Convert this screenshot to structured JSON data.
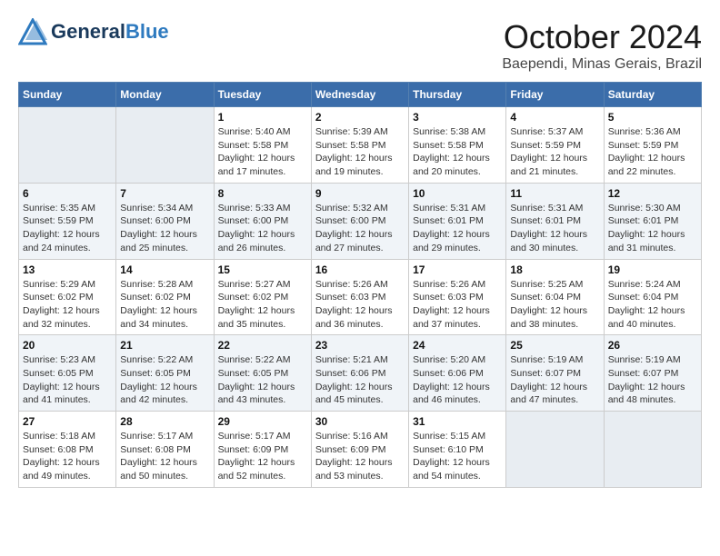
{
  "header": {
    "logo_general": "General",
    "logo_blue": "Blue",
    "month": "October 2024",
    "location": "Baependi, Minas Gerais, Brazil"
  },
  "days_of_week": [
    "Sunday",
    "Monday",
    "Tuesday",
    "Wednesday",
    "Thursday",
    "Friday",
    "Saturday"
  ],
  "weeks": [
    [
      {
        "num": "",
        "sunrise": "",
        "sunset": "",
        "daylight": ""
      },
      {
        "num": "",
        "sunrise": "",
        "sunset": "",
        "daylight": ""
      },
      {
        "num": "1",
        "sunrise": "Sunrise: 5:40 AM",
        "sunset": "Sunset: 5:58 PM",
        "daylight": "Daylight: 12 hours and 17 minutes."
      },
      {
        "num": "2",
        "sunrise": "Sunrise: 5:39 AM",
        "sunset": "Sunset: 5:58 PM",
        "daylight": "Daylight: 12 hours and 19 minutes."
      },
      {
        "num": "3",
        "sunrise": "Sunrise: 5:38 AM",
        "sunset": "Sunset: 5:58 PM",
        "daylight": "Daylight: 12 hours and 20 minutes."
      },
      {
        "num": "4",
        "sunrise": "Sunrise: 5:37 AM",
        "sunset": "Sunset: 5:59 PM",
        "daylight": "Daylight: 12 hours and 21 minutes."
      },
      {
        "num": "5",
        "sunrise": "Sunrise: 5:36 AM",
        "sunset": "Sunset: 5:59 PM",
        "daylight": "Daylight: 12 hours and 22 minutes."
      }
    ],
    [
      {
        "num": "6",
        "sunrise": "Sunrise: 5:35 AM",
        "sunset": "Sunset: 5:59 PM",
        "daylight": "Daylight: 12 hours and 24 minutes."
      },
      {
        "num": "7",
        "sunrise": "Sunrise: 5:34 AM",
        "sunset": "Sunset: 6:00 PM",
        "daylight": "Daylight: 12 hours and 25 minutes."
      },
      {
        "num": "8",
        "sunrise": "Sunrise: 5:33 AM",
        "sunset": "Sunset: 6:00 PM",
        "daylight": "Daylight: 12 hours and 26 minutes."
      },
      {
        "num": "9",
        "sunrise": "Sunrise: 5:32 AM",
        "sunset": "Sunset: 6:00 PM",
        "daylight": "Daylight: 12 hours and 27 minutes."
      },
      {
        "num": "10",
        "sunrise": "Sunrise: 5:31 AM",
        "sunset": "Sunset: 6:01 PM",
        "daylight": "Daylight: 12 hours and 29 minutes."
      },
      {
        "num": "11",
        "sunrise": "Sunrise: 5:31 AM",
        "sunset": "Sunset: 6:01 PM",
        "daylight": "Daylight: 12 hours and 30 minutes."
      },
      {
        "num": "12",
        "sunrise": "Sunrise: 5:30 AM",
        "sunset": "Sunset: 6:01 PM",
        "daylight": "Daylight: 12 hours and 31 minutes."
      }
    ],
    [
      {
        "num": "13",
        "sunrise": "Sunrise: 5:29 AM",
        "sunset": "Sunset: 6:02 PM",
        "daylight": "Daylight: 12 hours and 32 minutes."
      },
      {
        "num": "14",
        "sunrise": "Sunrise: 5:28 AM",
        "sunset": "Sunset: 6:02 PM",
        "daylight": "Daylight: 12 hours and 34 minutes."
      },
      {
        "num": "15",
        "sunrise": "Sunrise: 5:27 AM",
        "sunset": "Sunset: 6:02 PM",
        "daylight": "Daylight: 12 hours and 35 minutes."
      },
      {
        "num": "16",
        "sunrise": "Sunrise: 5:26 AM",
        "sunset": "Sunset: 6:03 PM",
        "daylight": "Daylight: 12 hours and 36 minutes."
      },
      {
        "num": "17",
        "sunrise": "Sunrise: 5:26 AM",
        "sunset": "Sunset: 6:03 PM",
        "daylight": "Daylight: 12 hours and 37 minutes."
      },
      {
        "num": "18",
        "sunrise": "Sunrise: 5:25 AM",
        "sunset": "Sunset: 6:04 PM",
        "daylight": "Daylight: 12 hours and 38 minutes."
      },
      {
        "num": "19",
        "sunrise": "Sunrise: 5:24 AM",
        "sunset": "Sunset: 6:04 PM",
        "daylight": "Daylight: 12 hours and 40 minutes."
      }
    ],
    [
      {
        "num": "20",
        "sunrise": "Sunrise: 5:23 AM",
        "sunset": "Sunset: 6:05 PM",
        "daylight": "Daylight: 12 hours and 41 minutes."
      },
      {
        "num": "21",
        "sunrise": "Sunrise: 5:22 AM",
        "sunset": "Sunset: 6:05 PM",
        "daylight": "Daylight: 12 hours and 42 minutes."
      },
      {
        "num": "22",
        "sunrise": "Sunrise: 5:22 AM",
        "sunset": "Sunset: 6:05 PM",
        "daylight": "Daylight: 12 hours and 43 minutes."
      },
      {
        "num": "23",
        "sunrise": "Sunrise: 5:21 AM",
        "sunset": "Sunset: 6:06 PM",
        "daylight": "Daylight: 12 hours and 45 minutes."
      },
      {
        "num": "24",
        "sunrise": "Sunrise: 5:20 AM",
        "sunset": "Sunset: 6:06 PM",
        "daylight": "Daylight: 12 hours and 46 minutes."
      },
      {
        "num": "25",
        "sunrise": "Sunrise: 5:19 AM",
        "sunset": "Sunset: 6:07 PM",
        "daylight": "Daylight: 12 hours and 47 minutes."
      },
      {
        "num": "26",
        "sunrise": "Sunrise: 5:19 AM",
        "sunset": "Sunset: 6:07 PM",
        "daylight": "Daylight: 12 hours and 48 minutes."
      }
    ],
    [
      {
        "num": "27",
        "sunrise": "Sunrise: 5:18 AM",
        "sunset": "Sunset: 6:08 PM",
        "daylight": "Daylight: 12 hours and 49 minutes."
      },
      {
        "num": "28",
        "sunrise": "Sunrise: 5:17 AM",
        "sunset": "Sunset: 6:08 PM",
        "daylight": "Daylight: 12 hours and 50 minutes."
      },
      {
        "num": "29",
        "sunrise": "Sunrise: 5:17 AM",
        "sunset": "Sunset: 6:09 PM",
        "daylight": "Daylight: 12 hours and 52 minutes."
      },
      {
        "num": "30",
        "sunrise": "Sunrise: 5:16 AM",
        "sunset": "Sunset: 6:09 PM",
        "daylight": "Daylight: 12 hours and 53 minutes."
      },
      {
        "num": "31",
        "sunrise": "Sunrise: 5:15 AM",
        "sunset": "Sunset: 6:10 PM",
        "daylight": "Daylight: 12 hours and 54 minutes."
      },
      {
        "num": "",
        "sunrise": "",
        "sunset": "",
        "daylight": ""
      },
      {
        "num": "",
        "sunrise": "",
        "sunset": "",
        "daylight": ""
      }
    ]
  ]
}
